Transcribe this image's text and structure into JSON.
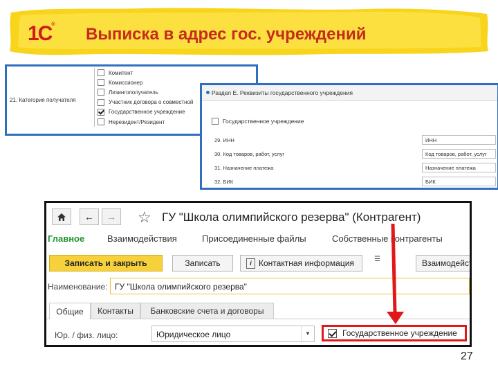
{
  "slide": {
    "title": "Выписка в адрес гос. учреждений",
    "logo_text": "1С",
    "logo_mark": "®",
    "page_number": "27"
  },
  "colors": {
    "accent_red": "#d11919",
    "frame_blue": "#2f6fbf",
    "highlight_red": "#e01818",
    "primary_button": "#f7d13c",
    "section_active": "#1f9430"
  },
  "recipient_panel": {
    "label": "21. Категория получателя",
    "items": [
      {
        "label": "Комитент",
        "checked": false
      },
      {
        "label": "Комиссионер",
        "checked": false
      },
      {
        "label": "Лизингополучатель",
        "checked": false
      },
      {
        "label": "Участник договора о совместной",
        "checked": false
      },
      {
        "label": "Государственное учреждение",
        "checked": true
      },
      {
        "label": "Нерезидент/Резидент",
        "checked": false
      }
    ]
  },
  "requisites_panel": {
    "header": "Раздел Е. Реквизиты государственного учреждения",
    "checkbox_label": "Государственное учреждение",
    "rows": [
      {
        "label": "29. ИНН",
        "value": "ИНН"
      },
      {
        "label": "30. Код товаров, работ, услуг",
        "value": "Код товаров, работ, услуг"
      },
      {
        "label": "31. Назначение платежа",
        "value": "Назначение платежа"
      },
      {
        "label": "32. БИК",
        "value": "БИК"
      }
    ]
  },
  "window": {
    "home_icon": "home-icon",
    "title": "ГУ \"Школа олимпийского резерва\" (Контрагент)",
    "sections": [
      "Главное",
      "Взаимодействия",
      "Присоединенные файлы",
      "Собственные контрагенты"
    ],
    "toolbar": {
      "save_close": "Записать и закрыть",
      "save": "Записать",
      "contact_info": "Контактная информация",
      "interactions": "Взаимодействия"
    },
    "name_label": "Наименование:",
    "name_value": "ГУ \"Школа олимпийского резерва\"",
    "tabs": [
      "Общие",
      "Контакты",
      "Банковские счета и договоры"
    ],
    "entity_type_label": "Юр. / физ. лицо:",
    "entity_type_value": "Юридическое лицо",
    "gov_checkbox_label": "Государственное учреждение",
    "gov_checkbox_checked": true
  }
}
